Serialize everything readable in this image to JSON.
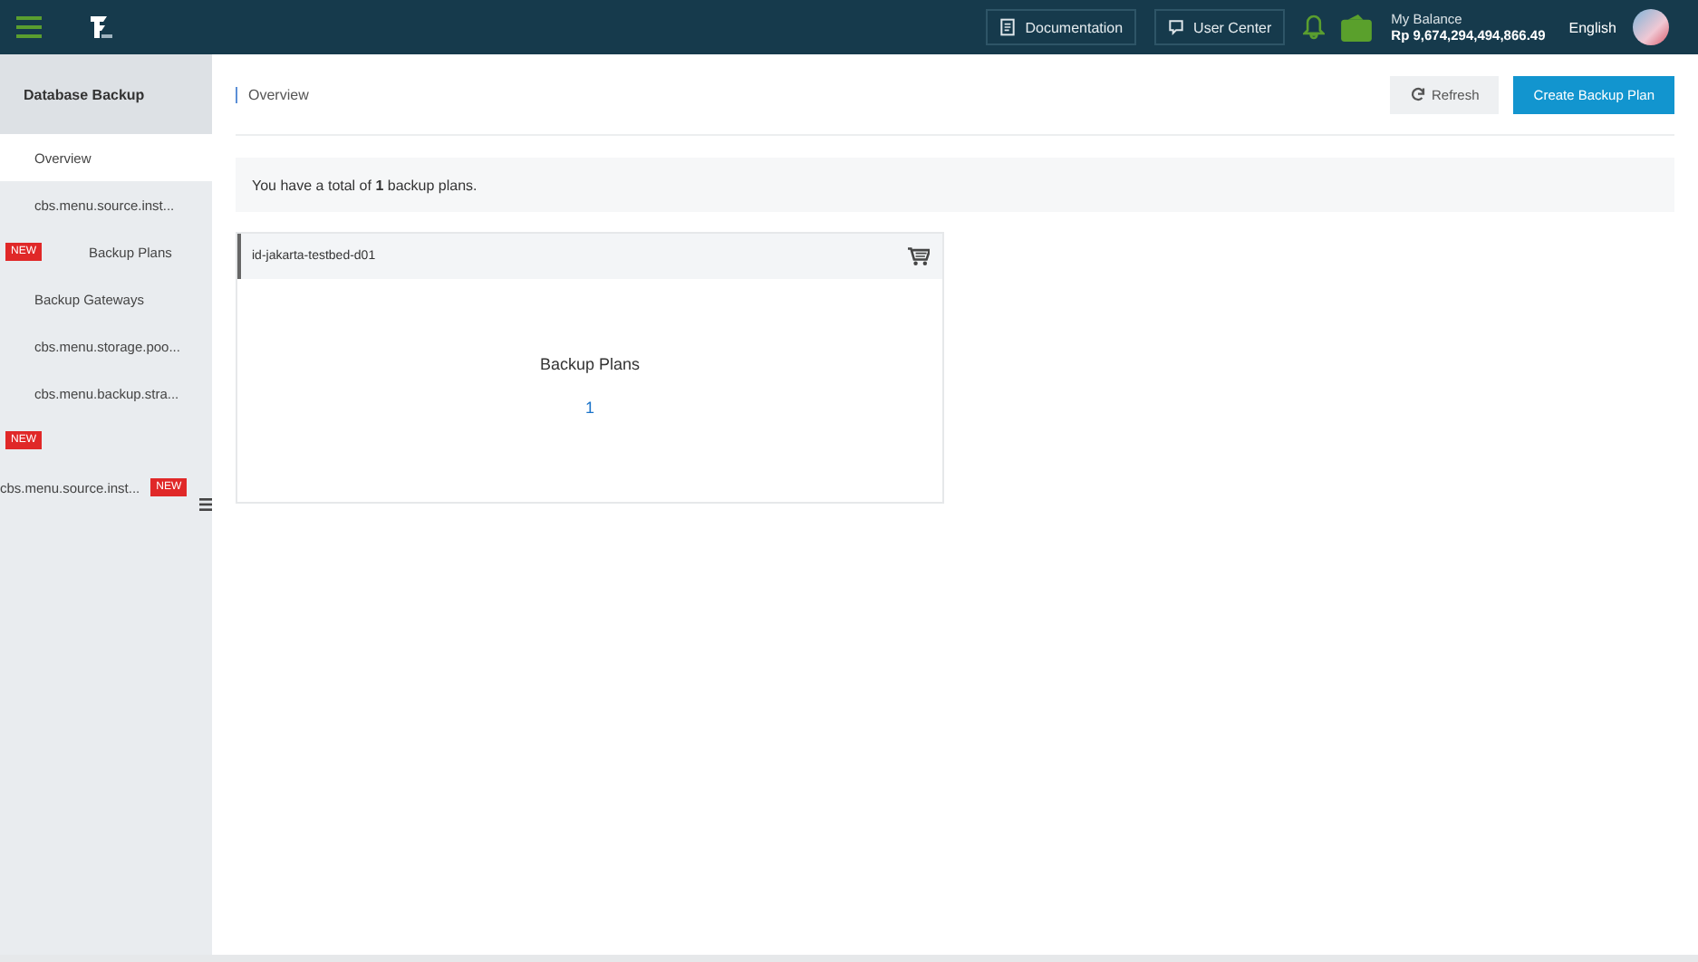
{
  "topbar": {
    "buttons": [
      {
        "kind": "doc",
        "label": "Documentation"
      },
      {
        "kind": "chat",
        "label": "User Center"
      }
    ],
    "balance": {
      "label": "My Balance",
      "amount": "Rp 9,674,294,494,866.49"
    },
    "language": "English"
  },
  "sidebar": {
    "title": "Database Backup",
    "items": [
      {
        "label": "Overview",
        "selected": true
      },
      {
        "label": "cbs.menu.source.inst...",
        "selected": false
      },
      {
        "label": "Backup Plans",
        "badge": "NEW",
        "badge_trailing": false,
        "selected": false
      },
      {
        "label": "Backup Gateways",
        "selected": false
      },
      {
        "label": "cbs.menu.storage.poo...",
        "selected": false
      },
      {
        "label": "cbs.menu.backup.stra...",
        "selected": false
      },
      {
        "badge": "NEW",
        "badge_trailing": false,
        "selected": false
      },
      {
        "label": "cbs.menu.source.inst...",
        "badge": "NEW",
        "badge_trailing": true,
        "selected": false
      }
    ]
  },
  "header": {
    "title": "Overview",
    "buttons": [
      {
        "kind": "secondary",
        "label": "Refresh"
      },
      {
        "kind": "primary",
        "label": "Create Backup Plan"
      }
    ]
  },
  "summary": "You have a total of **1** backup plans.",
  "cards": [
    {
      "region": "id-jakarta-testbed-d01",
      "metric_label": "Backup Plans",
      "metric_value": "1"
    }
  ]
}
